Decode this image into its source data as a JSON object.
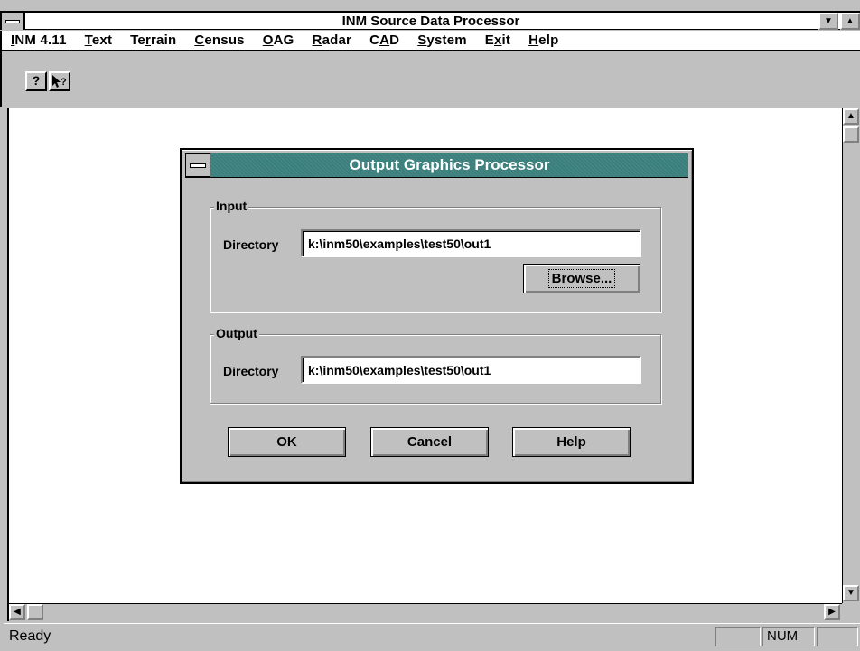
{
  "app": {
    "title": "INM Source Data Processor"
  },
  "menu": [
    {
      "label": "INM 4.11",
      "underline": "I",
      "rest": "NM 4.11"
    },
    {
      "label": "Text",
      "underline": "T",
      "rest": "ext"
    },
    {
      "label": "Terrain",
      "pre": "Te",
      "underline": "r",
      "rest": "rain"
    },
    {
      "label": "Census",
      "underline": "C",
      "rest": "ensus"
    },
    {
      "label": "OAG",
      "underline": "O",
      "rest": "AG"
    },
    {
      "label": "Radar",
      "underline": "R",
      "rest": "adar"
    },
    {
      "label": "CAD",
      "pre": "C",
      "underline": "A",
      "rest": "D"
    },
    {
      "label": "System",
      "underline": "S",
      "rest": "ystem"
    },
    {
      "label": "Exit",
      "pre": "E",
      "underline": "x",
      "rest": "it"
    },
    {
      "label": "Help",
      "underline": "H",
      "rest": "elp"
    }
  ],
  "toolbar": {
    "help_icon": "help-icon",
    "context_help_icon": "context-help-icon"
  },
  "dialog": {
    "title": "Output Graphics Processor",
    "input_group": "Input",
    "input_dir_label": "Directory",
    "input_dir_value": "k:\\inm50\\examples\\test50\\out1",
    "browse_label": "Browse...",
    "output_group": "Output",
    "output_dir_label": "Directory",
    "output_dir_value": "k:\\inm50\\examples\\test50\\out1",
    "ok_label": "OK",
    "cancel_label": "Cancel",
    "help_label": "Help"
  },
  "status": {
    "text": "Ready",
    "num_indicator": "NUM"
  },
  "colors": {
    "dialog_title_bg": "#3a7f7c",
    "face": "#c0c0c0"
  }
}
